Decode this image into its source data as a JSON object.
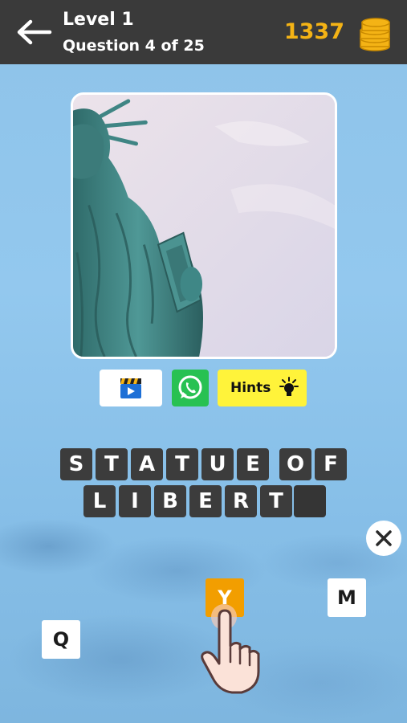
{
  "header": {
    "level_title": "Level 1",
    "question_count": "Question 4 of 25",
    "coins": "1337"
  },
  "photo": {
    "subject": "Statue of Liberty"
  },
  "actions": {
    "video_icon": "clapperboard-video-icon",
    "whatsapp_icon": "whatsapp-icon",
    "hints_label": "Hints",
    "hints_icon": "lightbulb-icon"
  },
  "answer": {
    "row1": [
      "S",
      "T",
      "A",
      "T",
      "U",
      "E",
      "",
      "O",
      "F"
    ],
    "row2": [
      "L",
      "I",
      "B",
      "E",
      "R",
      "T",
      ""
    ]
  },
  "keys": {
    "q": "Q",
    "y": "Y",
    "m": "M"
  },
  "icons": {
    "back": "back-arrow-icon",
    "coins": "coin-stack-icon",
    "clear": "close-icon",
    "hand": "pointing-hand-icon"
  },
  "colors": {
    "header_bg": "#3a3a3a",
    "coin_text": "#f4b315",
    "tile_bg": "#3c3c3c",
    "hints_bg": "#fff33a",
    "whatsapp_bg": "#28c152",
    "active_key": "#f29e00"
  }
}
